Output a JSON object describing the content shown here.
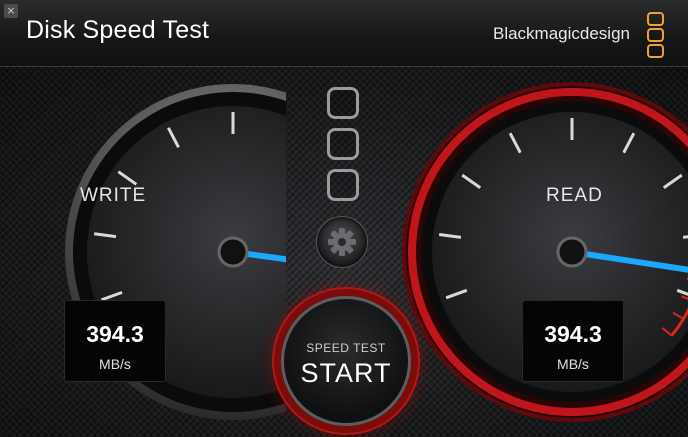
{
  "window": {
    "title": "Disk Speed Test",
    "close_glyph": "×"
  },
  "brand": {
    "name": "Blackmagicdesign",
    "logo_icon": "blackmagic-logo-icon",
    "accent_color": "#f2a036"
  },
  "gauges": {
    "write": {
      "label": "WRITE",
      "value": "394.3",
      "unit": "MB/s",
      "needle_color": "#1aa9ff"
    },
    "read": {
      "label": "READ",
      "value": "394.3",
      "unit": "MB/s",
      "needle_color": "#1aa9ff",
      "ring_color": "#c0161b"
    }
  },
  "controls": {
    "start_top": "SPEED TEST",
    "start_main": "START",
    "settings_icon": "gear-icon",
    "slot_icons": [
      "slot-icon",
      "slot-icon",
      "slot-icon"
    ]
  }
}
